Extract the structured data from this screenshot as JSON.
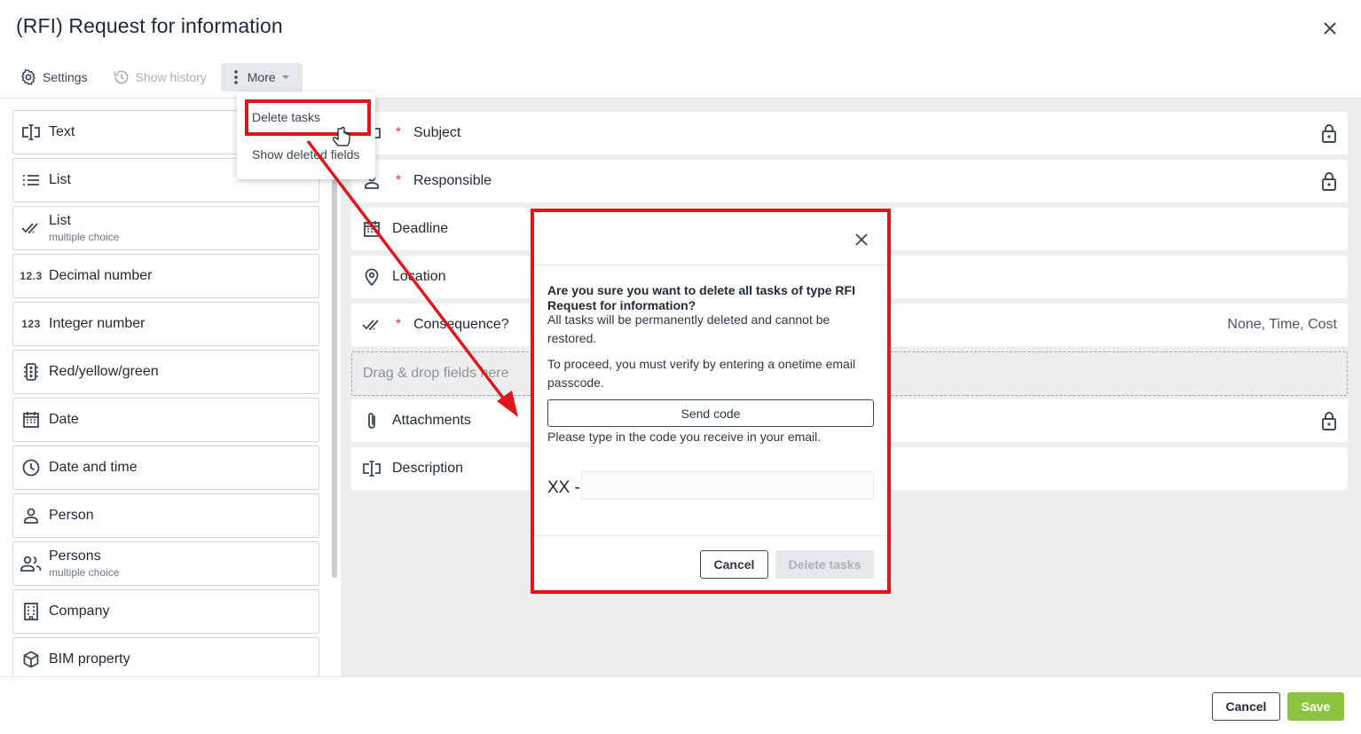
{
  "header": {
    "title": "(RFI) Request for information"
  },
  "toolbar": {
    "settings_label": "Settings",
    "history_label": "Show history",
    "more_label": "More"
  },
  "more_menu": {
    "items": [
      "Delete tasks",
      "Show deleted fields"
    ]
  },
  "palette": {
    "items": [
      {
        "label": "Text",
        "sub": "",
        "icon": "text-field-icon"
      },
      {
        "label": "List",
        "sub": "",
        "icon": "list-icon"
      },
      {
        "label": "List",
        "sub": "multiple choice",
        "icon": "double-check-icon"
      },
      {
        "label": "Decimal number",
        "sub": "",
        "icon": "decimal-icon"
      },
      {
        "label": "Integer number",
        "sub": "",
        "icon": "integer-icon"
      },
      {
        "label": "Red/yellow/green",
        "sub": "",
        "icon": "traffic-light-icon"
      },
      {
        "label": "Date",
        "sub": "",
        "icon": "calendar-icon"
      },
      {
        "label": "Date and time",
        "sub": "",
        "icon": "clock-icon"
      },
      {
        "label": "Person",
        "sub": "",
        "icon": "person-icon"
      },
      {
        "label": "Persons",
        "sub": "multiple choice",
        "icon": "persons-icon"
      },
      {
        "label": "Company",
        "sub": "",
        "icon": "building-icon"
      },
      {
        "label": "BIM property",
        "sub": "",
        "icon": "cube-icon"
      }
    ]
  },
  "form": {
    "fields": [
      {
        "label": "Subject",
        "required": "*",
        "right": ""
      },
      {
        "label": "Responsible",
        "required": "*",
        "right": ""
      },
      {
        "label": "Deadline",
        "required": "",
        "right": ""
      },
      {
        "label": "Location",
        "required": "",
        "right": ""
      },
      {
        "label": "Consequence?",
        "required": "*",
        "right": "None, Time, Cost"
      }
    ],
    "dropzone": "Drag & drop fields here",
    "bottom_fields": [
      {
        "label": "Attachments"
      },
      {
        "label": "Description"
      }
    ]
  },
  "footer": {
    "cancel_label": "Cancel",
    "save_label": "Save"
  },
  "modal": {
    "heading": "Are you sure you want to delete all tasks of type RFI Request for information?",
    "warning": "All tasks will be permanently deleted and cannot be restored.",
    "verify_text": "To proceed, you must verify by entering a onetime email passcode.",
    "send_code_label": "Send code",
    "hint": "Please type in the code you receive in your email.",
    "code_prefix": "XX -",
    "code_value": "",
    "cancel_label": "Cancel",
    "delete_label": "Delete tasks"
  },
  "colors": {
    "accent_green": "#8cc43f",
    "highlight_red": "#e0161d",
    "required_red": "#d9342b"
  }
}
